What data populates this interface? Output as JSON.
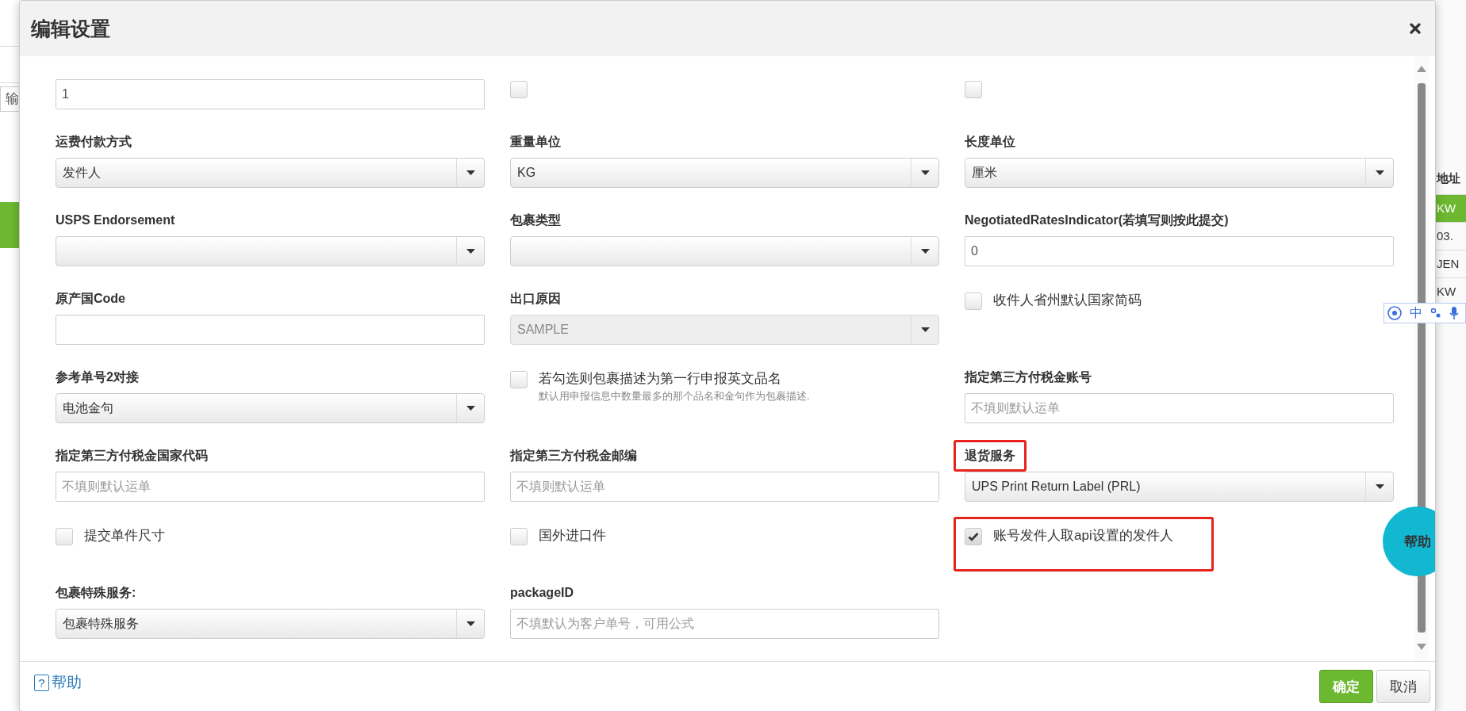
{
  "backdrop": {
    "left_field": "输",
    "right_cells": [
      {
        "text": "地址",
        "kind": "header"
      },
      {
        "text": "KW",
        "kind": "active"
      },
      {
        "text": "03.",
        "kind": "plain"
      },
      {
        "text": "JEN",
        "kind": "plain"
      },
      {
        "text": "KW",
        "kind": "plain"
      }
    ]
  },
  "ime_toolbar": {
    "label": "中"
  },
  "dialog": {
    "title": "编辑设置",
    "rows": [
      {
        "cells": [
          {
            "kind": "input",
            "value": "1"
          },
          {
            "kind": "checkbox",
            "checked": false
          },
          {
            "kind": "checkbox",
            "checked": false
          }
        ]
      },
      {
        "cells": [
          {
            "kind": "select",
            "label": "运费付款方式",
            "value": "发件人",
            "disabled": false
          },
          {
            "kind": "select",
            "label": "重量单位",
            "value": "KG",
            "disabled": false
          },
          {
            "kind": "select",
            "label": "长度单位",
            "value": "厘米",
            "disabled": false
          }
        ]
      },
      {
        "cells": [
          {
            "kind": "select",
            "label": "USPS Endorsement",
            "disabled": false
          },
          {
            "kind": "select",
            "label": "包裹类型",
            "disabled": false
          },
          {
            "kind": "input",
            "label": "NegotiatedRatesIndicator(若填写则按此提交)",
            "value": "0"
          }
        ]
      },
      {
        "cells": [
          {
            "kind": "input",
            "label": "原产国Code"
          },
          {
            "kind": "select",
            "label": "出口原因",
            "value": "SAMPLE",
            "disabled": true
          },
          {
            "kind": "checkbox",
            "label": "收件人省州默认国家简码",
            "checked": false
          }
        ]
      },
      {
        "cells": [
          {
            "kind": "select",
            "label": "参考单号2对接",
            "value": "电池金句",
            "disabled": false
          },
          {
            "kind": "checkbox",
            "label": "若勾选则包裹描述为第一行申报英文品名",
            "note": "默认用申报信息中数量最多的那个品名和金句作为包裹描述.",
            "checked": false
          },
          {
            "kind": "input",
            "label": "指定第三方付税金账号",
            "placeholder": "不填则默认运单"
          }
        ]
      },
      {
        "cells": [
          {
            "kind": "input",
            "label": "指定第三方付税金国家代码",
            "placeholder": "不填则默认运单"
          },
          {
            "kind": "input",
            "label": "指定第三方付税金邮编",
            "placeholder": "不填则默认运单"
          },
          {
            "kind": "select",
            "label": "退货服务",
            "value": "UPS Print Return Label (PRL)",
            "disabled": false,
            "highlighted": true
          }
        ]
      },
      {
        "cells": [
          {
            "kind": "checkbox",
            "label": "提交单件尺寸",
            "checked": false
          },
          {
            "kind": "checkbox",
            "label": "国外进口件",
            "checked": false
          },
          {
            "kind": "checkbox",
            "label": "账号发件人取api设置的发件人",
            "checked": true,
            "highlighted": true
          }
        ]
      },
      {
        "cells": [
          {
            "kind": "select",
            "label": "包裹特殊服务:",
            "value": "包裹特殊服务",
            "disabled": false
          },
          {
            "kind": "input",
            "label": "packageID",
            "placeholder": "不填默认为客户单号，可用公式"
          }
        ]
      }
    ],
    "float_help": "帮助",
    "footer": {
      "help_icon": "?",
      "help_link": "帮助",
      "buttons": [
        {
          "label": "确定",
          "kind": "primary"
        },
        {
          "label": "取消",
          "kind": "default"
        }
      ]
    }
  }
}
